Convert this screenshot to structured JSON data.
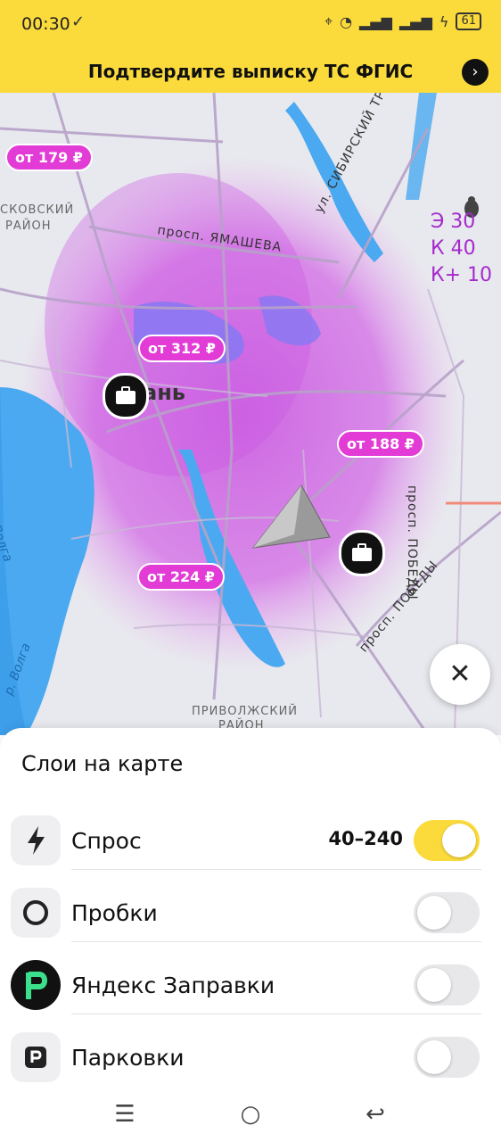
{
  "status_bar": {
    "time": "00:30",
    "battery": "61"
  },
  "banner": {
    "text": "Подтвердите выписку ТС ФГИС",
    "arrow_icon": "chevron-right-icon"
  },
  "map": {
    "price_tags": [
      {
        "label": "от 179 ₽"
      },
      {
        "label": "от 312 ₽"
      },
      {
        "label": "от 188 ₽"
      },
      {
        "label": "от 224 ₽"
      }
    ],
    "streets": {
      "yamasheva": "просп. ЯМАШЕВА",
      "sibirsky": "ул. СИБИРСКИЙ ТРАКТ",
      "pobedy_vertical": "просп. ПОБЕДЫ",
      "pobedy_diag": "просп. ПОБЕДЫ"
    },
    "districts": {
      "moskovsky_1": "СКОВСКИЙ",
      "moskovsky_2": "РАЙОН",
      "privolzhsky_1": "ПРИВОЛЖСКИЙ",
      "privolzhsky_2": "РАЙОН"
    },
    "rivers": {
      "volga_1": "Волга",
      "volga_2": "р. Волга"
    },
    "city_label": "ань",
    "stats": {
      "e": "Э 30",
      "k": "К 40",
      "kplus": "К+ 10"
    },
    "colors": {
      "demand": "#d15de0",
      "water": "#4aa9f0",
      "price_tag": "#e23bd6"
    }
  },
  "layers_sheet": {
    "title": "Слои на карте",
    "rows": [
      {
        "label": "Спрос",
        "value": "40–240",
        "enabled": true,
        "icon": "lightning-icon"
      },
      {
        "label": "Пробки",
        "enabled": false,
        "icon": "traffic-icon"
      },
      {
        "label": "Яндекс Заправки",
        "enabled": false,
        "icon": "yandex-fuel-icon"
      },
      {
        "label": "Парковки",
        "enabled": false,
        "icon": "parking-icon"
      }
    ]
  },
  "nav_bar": {
    "menu_icon": "menu-icon",
    "home_icon": "home-icon",
    "back_icon": "back-icon"
  }
}
